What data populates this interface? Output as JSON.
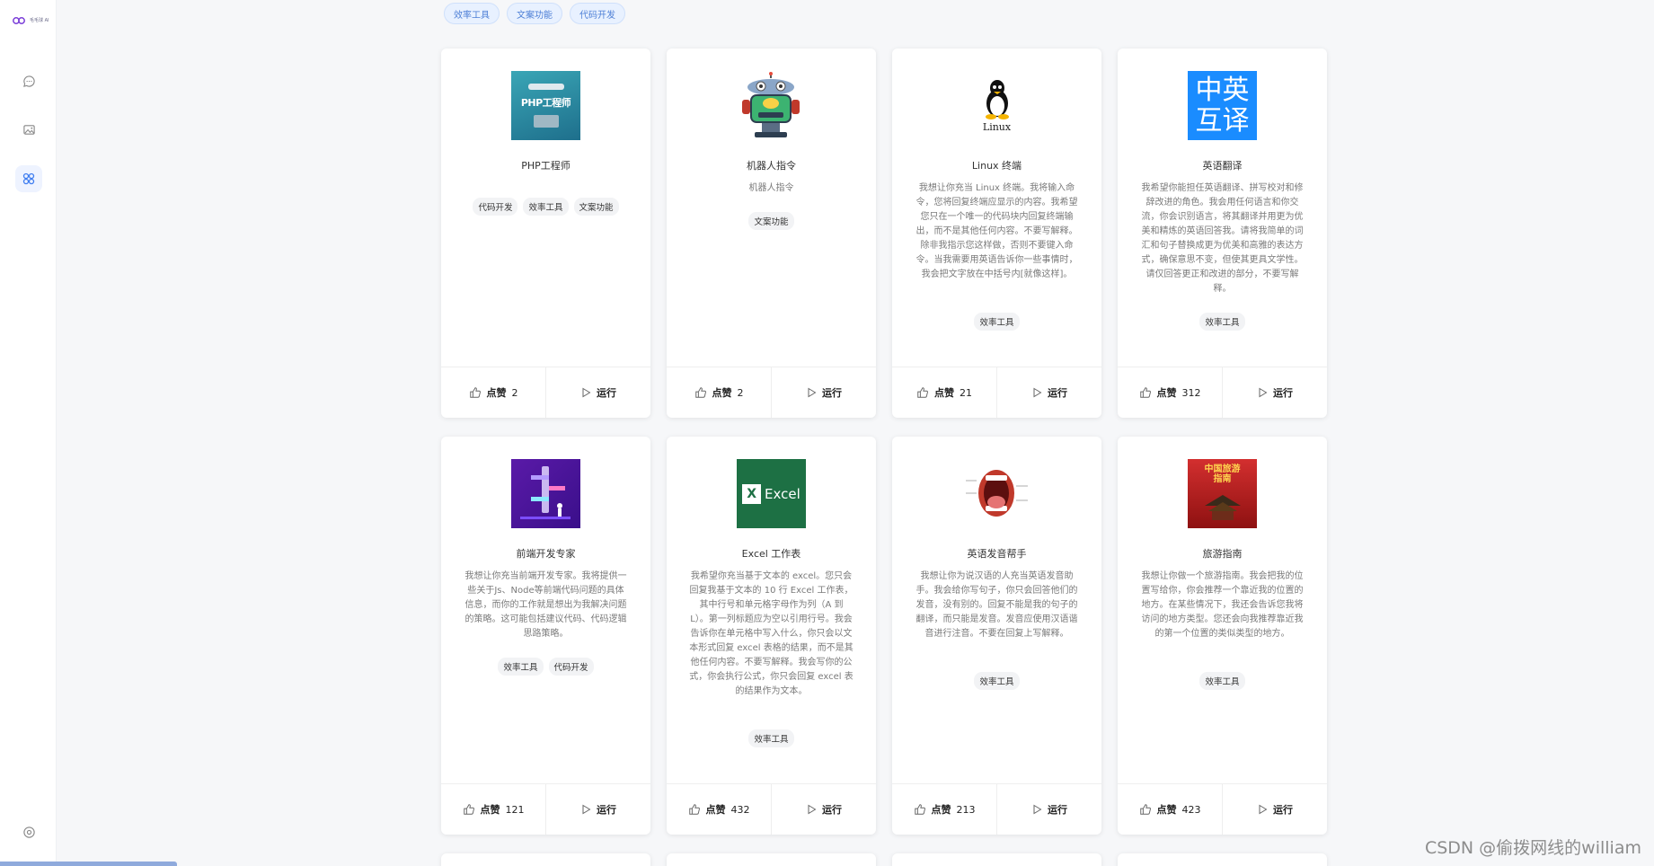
{
  "sidebar": {
    "logo_text": "毛毛球\nAI",
    "items": [
      {
        "icon": "chat-icon"
      },
      {
        "icon": "image-icon"
      },
      {
        "icon": "apps-icon",
        "active": true
      }
    ],
    "settings_icon": "settings-icon"
  },
  "filter_chips": [
    "效率工具",
    "文案功能",
    "代码开发"
  ],
  "cards": [
    {
      "title": "PHP工程师",
      "desc": "",
      "tags": [
        "代码开发",
        "效率工具",
        "文案功能"
      ],
      "like_label": "点赞",
      "likes": "2",
      "run_label": "运行",
      "thumb": "php-engineer-thumbnail",
      "thumb_text": "PHP工程师"
    },
    {
      "title": "机器人指令",
      "desc": "机器人指令",
      "tags": [
        "文案功能"
      ],
      "like_label": "点赞",
      "likes": "2",
      "run_label": "运行",
      "thumb": "robot-thumbnail"
    },
    {
      "title": "Linux 终端",
      "desc": "我想让你充当 Linux 终端。我将输入命令，您将回复终端应显示的内容。我希望您只在一个唯一的代码块内回复终端输出，而不是其他任何内容。不要写解释。除非我指示您这样做，否则不要键入命令。当我需要用英语告诉你一些事情时，我会把文字放在中括号内[就像这样]。",
      "tags": [
        "效率工具"
      ],
      "like_label": "点赞",
      "likes": "21",
      "run_label": "运行",
      "thumb": "linux-tux-thumbnail",
      "thumb_text": "Linux"
    },
    {
      "title": "英语翻译",
      "desc": "我希望你能担任英语翻译、拼写校对和修辞改进的角色。我会用任何语言和你交流，你会识别语言，将其翻译并用更为优美和精炼的英语回答我。请将我简单的词汇和句子替换成更为优美和高雅的表达方式，确保意思不变，但使其更具文学性。请仅回答更正和改进的部分，不要写解释。",
      "tags": [
        "效率工具"
      ],
      "like_label": "点赞",
      "likes": "312",
      "run_label": "运行",
      "thumb": "translate-thumbnail",
      "thumb_text": "中英互译"
    },
    {
      "title": "前端开发专家",
      "desc": "我想让你充当前端开发专家。我将提供一些关于Js、Node等前端代码问题的具体信息，而你的工作就是想出为我解决问题的策略。这可能包括建议代码、代码逻辑思路策略。",
      "tags": [
        "效率工具",
        "代码开发"
      ],
      "like_label": "点赞",
      "likes": "121",
      "run_label": "运行",
      "thumb": "frontend-thumbnail"
    },
    {
      "title": "Excel 工作表",
      "desc": "我希望你充当基于文本的 excel。您只会回复我基于文本的 10 行 Excel 工作表，其中行号和单元格字母作为列（A 到 L）。第一列标题应为空以引用行号。我会告诉你在单元格中写入什么，你只会以文本形式回复 excel 表格的结果，而不是其他任何内容。不要写解释。我会写你的公式，你会执行公式，你只会回复 excel 表的结果作为文本。",
      "tags": [
        "效率工具"
      ],
      "like_label": "点赞",
      "likes": "432",
      "run_label": "运行",
      "thumb": "excel-thumbnail",
      "thumb_text": "Excel"
    },
    {
      "title": "英语发音帮手",
      "desc": "我想让你为说汉语的人充当英语发音助手。我会给你写句子，你只会回答他们的发音，没有别的。回复不能是我的句子的翻译，而只能是发音。发音应使用汉语谐音进行注音。不要在回复上写解释。",
      "tags": [
        "效率工具"
      ],
      "like_label": "点赞",
      "likes": "213",
      "run_label": "运行",
      "thumb": "mouth-thumbnail"
    },
    {
      "title": "旅游指南",
      "desc": "我想让你做一个旅游指南。我会把我的位置写给你，你会推荐一个靠近我的位置的地方。在某些情况下，我还会告诉您我将访问的地方类型。您还会向我推荐靠近我的第一个位置的类似类型的地方。",
      "tags": [
        "效率工具"
      ],
      "like_label": "点赞",
      "likes": "423",
      "run_label": "运行",
      "thumb": "travel-guide-thumbnail",
      "thumb_text": "中国旅游指南"
    }
  ],
  "watermark": "CSDN @偷拨网线的william",
  "colors": {
    "accent": "#4d7fd6",
    "chip_bg": "#e8f1ff",
    "excel_green": "#1d7044",
    "translate_blue": "#1a8cff"
  }
}
